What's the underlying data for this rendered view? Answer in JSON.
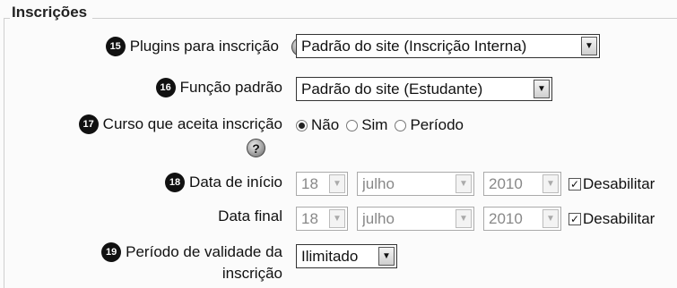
{
  "section": {
    "legend": "Inscrições"
  },
  "rows": {
    "plugins": {
      "badge": "15",
      "label": "Plugins para inscrição",
      "help": "?",
      "value": "Padrão do site (Inscrição Interna)"
    },
    "role": {
      "badge": "16",
      "label": "Função padrão",
      "value": "Padrão do site (Estudante)"
    },
    "enrollable": {
      "badge": "17",
      "label": "Curso que aceita inscrição",
      "help": "?",
      "options": [
        {
          "label": "Não",
          "checked": true
        },
        {
          "label": "Sim",
          "checked": false
        },
        {
          "label": "Período",
          "checked": false
        }
      ]
    },
    "start_date": {
      "badge": "18",
      "label": "Data de início",
      "day": "18",
      "month": "julho",
      "year": "2010",
      "disable_label": "Desabilitar",
      "disabled_checked": true
    },
    "end_date": {
      "label": "Data final",
      "day": "18",
      "month": "julho",
      "year": "2010",
      "disable_label": "Desabilitar",
      "disabled_checked": true
    },
    "validity": {
      "badge": "19",
      "label_line1": "Período de validade da",
      "label_line2": "inscrição",
      "value": "Ilimitado"
    }
  },
  "icons": {
    "dropdown_arrow": "▼",
    "checkmark": "✓",
    "help_icon": "question-circle"
  }
}
